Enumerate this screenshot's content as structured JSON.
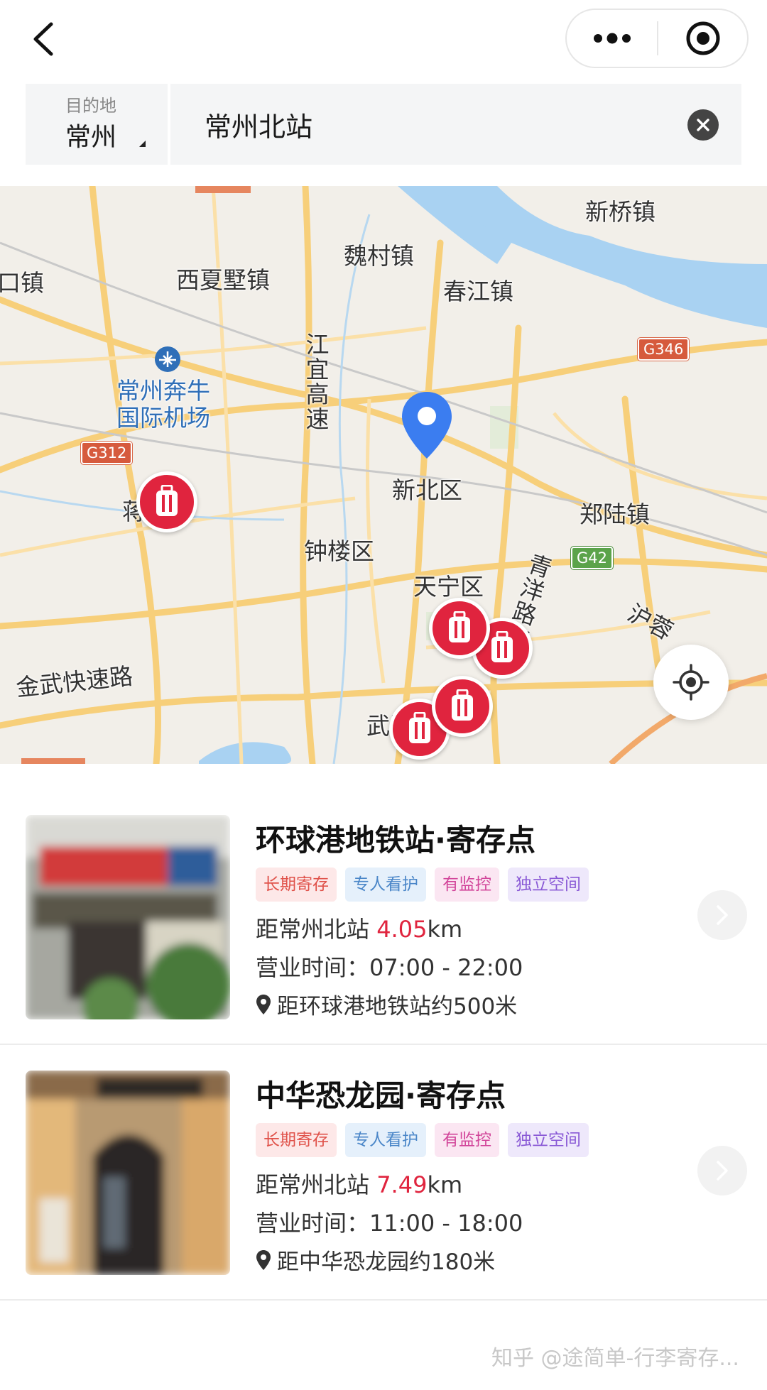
{
  "header": {
    "back_icon": "chevron-left-icon",
    "more_icon": "more-dots-icon",
    "close_icon": "target-circle-icon"
  },
  "search": {
    "destination_label": "目的地",
    "destination_city": "常州",
    "query": "常州北站",
    "clear_icon": "clear-x-icon"
  },
  "map": {
    "labels": {
      "xinqiao": "新桥镇",
      "weicun": "魏村镇",
      "xixiashu": "西夏墅镇",
      "chunjiang": "春江镇",
      "kou": "口镇",
      "airport1": "常州奔牛",
      "airport2": "国际机场",
      "jiangyi": "江宜高速",
      "xinbei": "新北区",
      "jishu": "蒋墅镇",
      "zhonglou": "钟楼区",
      "zhenglu": "郑陆镇",
      "tianning": "天宁区",
      "qingyang": "青洋路高架",
      "hurong": "沪蓉",
      "jinwu": "金武快速路",
      "wujin": "武进区"
    },
    "road_badges": {
      "g346": "G346",
      "g312": "G312",
      "g42": "G42"
    },
    "pin_icon": "luggage-icon",
    "locate_icon": "locate-crosshair-icon",
    "colors": {
      "pin": "#e0243e",
      "location_pin": "#3b7df0",
      "water": "#a9d2f2",
      "road": "#f7cf7a"
    }
  },
  "stations": [
    {
      "title": "环球港地铁站·寄存点",
      "tags": [
        "长期寄存",
        "专人看护",
        "有监控",
        "独立空间"
      ],
      "dist_prefix": "距常州北站 ",
      "dist_value": "4.05",
      "dist_unit": "km",
      "hours": "营业时间：07:00 - 22:00",
      "near": "距环球港地铁站约500米"
    },
    {
      "title": "中华恐龙园·寄存点",
      "tags": [
        "长期寄存",
        "专人看护",
        "有监控",
        "独立空间"
      ],
      "dist_prefix": "距常州北站 ",
      "dist_value": "7.49",
      "dist_unit": "km",
      "hours": "营业时间：11:00 - 18:00",
      "near": "距中华恐龙园约180米"
    }
  ],
  "watermark": "知乎 @途简单-行李寄存..."
}
